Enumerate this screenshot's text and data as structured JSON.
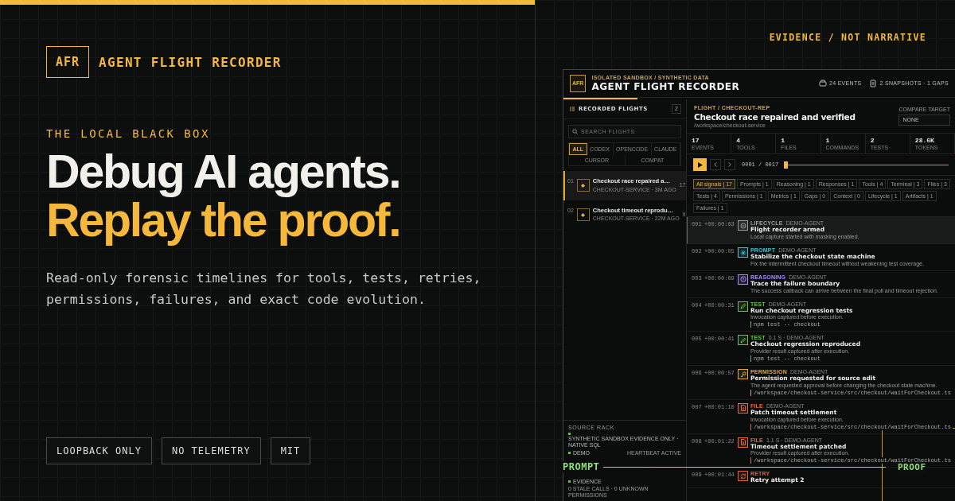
{
  "brand": {
    "mark": "AFR",
    "name": "AGENT FLIGHT RECORDER"
  },
  "eyebrow": "THE LOCAL BLACK BOX",
  "headline": [
    {
      "text": "Debug AI agents.",
      "accent": false
    },
    {
      "text": "Replay the proof.",
      "accent": true
    }
  ],
  "lede": "Read-only forensic timelines for tools, tests, retries, permissions, failures, and exact code evolution.",
  "badges": [
    "LOOPBACK ONLY",
    "NO TELEMETRY",
    "MIT"
  ],
  "tagline": "EVIDENCE / NOT NARRATIVE",
  "app": {
    "mark": "AFR",
    "subtitle": "ISOLATED SANDBOX / SYNTHETIC DATA",
    "title": "AGENT FLIGHT RECORDER",
    "header_stats": [
      {
        "kind": "events",
        "text": "24 EVENTS"
      },
      {
        "kind": "snapshots",
        "text": "2 SNAPSHOTS · 1 GAPS"
      }
    ],
    "load": {
      "level": 0.19
    },
    "sidebar": {
      "title": "RECORDED FLIGHTS",
      "count": "2",
      "search_placeholder": "SEARCH FLIGHTS",
      "filters": [
        {
          "label": "ALL",
          "selected": true
        },
        {
          "label": "CODEX",
          "selected": false
        },
        {
          "label": "OPENCODE",
          "selected": false
        },
        {
          "label": "CLAUDE",
          "selected": false
        },
        {
          "label": "CURSOR",
          "selected": false
        },
        {
          "label": "COMPAT",
          "selected": false
        }
      ],
      "flights": [
        {
          "index": "01",
          "title": "Checkout race repaired a…",
          "meta": "CHECKOUT-SERVICE · 3M AGO",
          "count": "17",
          "selected": true
        },
        {
          "index": "02",
          "title": "Checkout timeout reprodu…",
          "meta": "CHECKOUT-SERVICE · 22M AGO",
          "count": "9",
          "selected": false
        }
      ],
      "source_rack": {
        "title": "SOURCE RACK",
        "lines": [
          {
            "label": "SYNTHETIC SANDBOX EVIDENCE ONLY · NATIVE SQL"
          },
          {
            "label": "DEMO",
            "value": "HEARTBEAT ACTIVE"
          },
          {
            "label": "EVIDENCE",
            "value": "0 STALE CALLS · 0 UNKNOWN PERMISSIONS"
          }
        ]
      }
    },
    "flight": {
      "breadcrumb": "FLIGHT / CHECKOUT-REP",
      "title": "Checkout race repaired and verified",
      "path": "/workspace/checkout-service",
      "compare": {
        "label": "COMPARE TARGET",
        "value": "NONE"
      },
      "stats": [
        {
          "value": "17",
          "label": "EVENTS"
        },
        {
          "value": "4",
          "label": "TOOLS"
        },
        {
          "value": "1",
          "label": "FILES"
        },
        {
          "value": "1",
          "label": "COMMANDS"
        },
        {
          "value": "2",
          "label": "TESTS"
        },
        {
          "value": "28.6K",
          "label": "TOKENS"
        }
      ],
      "playback": {
        "position": "0001 / 0017",
        "level": 0
      },
      "signals": [
        {
          "label": "All signals | 17",
          "selected": true
        },
        {
          "label": "Prompts | 1",
          "selected": false
        },
        {
          "label": "Reasoning | 1",
          "selected": false
        },
        {
          "label": "Responses | 1",
          "selected": false
        },
        {
          "label": "Tools | 4",
          "selected": false
        },
        {
          "label": "Terminal | 3",
          "selected": false
        },
        {
          "label": "Files | 3",
          "selected": false
        },
        {
          "label": "Tests | 4",
          "selected": false
        },
        {
          "label": "Permissions | 1",
          "selected": false
        },
        {
          "label": "Metrics | 1",
          "selected": false
        },
        {
          "label": "Gaps | 0",
          "selected": false
        },
        {
          "label": "Context | 0",
          "selected": false
        },
        {
          "label": "Lifecycle | 1",
          "selected": false
        },
        {
          "label": "Artifacts | 1",
          "selected": false
        },
        {
          "label": "Failures | 1",
          "selected": false
        }
      ],
      "events": [
        {
          "kind": "lifecycle",
          "num": "001",
          "time": "+00:00:03",
          "tag": "LIFECYCLE",
          "meta": "DEMO-AGENT",
          "title": "Flight recorder armed",
          "detail": "Local capture started with masking enabled.",
          "selected": true
        },
        {
          "kind": "prompt",
          "num": "002",
          "time": "+00:00:05",
          "tag": "PROMPT",
          "meta": "DEMO-AGENT",
          "title": "Stabilize the checkout state machine",
          "detail": "Fix the intermittent checkout timeout without weakening test coverage.",
          "selected": false
        },
        {
          "kind": "reasoning",
          "num": "003",
          "time": "+00:00:09",
          "tag": "REASONING",
          "meta": "DEMO-AGENT",
          "title": "Trace the failure boundary",
          "detail": "The success callback can arrive between the final poll and timeout rejection.",
          "selected": false
        },
        {
          "kind": "test",
          "num": "004",
          "time": "+00:00:31",
          "tag": "TEST",
          "meta": "DEMO-AGENT",
          "title": "Run checkout regression tests",
          "detail": "Invocation captured before execution.",
          "code": "npm test -- checkout",
          "selected": false
        },
        {
          "kind": "test",
          "num": "005",
          "time": "+00:00:41",
          "tag": "TEST",
          "meta": "0.1 S · DEMO-AGENT",
          "title": "Checkout regression reproduced",
          "detail": "Provider result captured after execution.",
          "code": "npm test -- checkout",
          "selected": false
        },
        {
          "kind": "permission",
          "num": "006",
          "time": "+00:00:57",
          "tag": "PERMISSION",
          "meta": "DEMO-AGENT",
          "title": "Permission requested for source edit",
          "detail": "The agent requested approval before changing the checkout state machine.",
          "code": "/workspace/checkout-service/src/checkout/waitForCheckout.ts",
          "selected": false
        },
        {
          "kind": "file",
          "num": "007",
          "time": "+00:01:10",
          "tag": "FILE",
          "meta": "DEMO-AGENT",
          "title": "Patch timeout settlement",
          "detail": "Invocation captured before execution.",
          "code": "/workspace/checkout-service/src/checkout/waitForCheckout.ts",
          "selected": false
        },
        {
          "kind": "file",
          "num": "008",
          "time": "+00:01:22",
          "tag": "FILE",
          "meta": "1.1 S · DEMO-AGENT",
          "title": "Timeout settlement patched",
          "detail": "Provider result captured after execution.",
          "code": "/workspace/checkout-service/src/checkout/waitForCheckout.ts",
          "selected": false
        },
        {
          "kind": "retry",
          "num": "009",
          "time": "+00:01:44",
          "tag": "RETRY",
          "title": "Retry attempt 2",
          "selected": false
        }
      ]
    }
  },
  "overlay": {
    "start": "PROMPT",
    "end": "PROOF"
  }
}
